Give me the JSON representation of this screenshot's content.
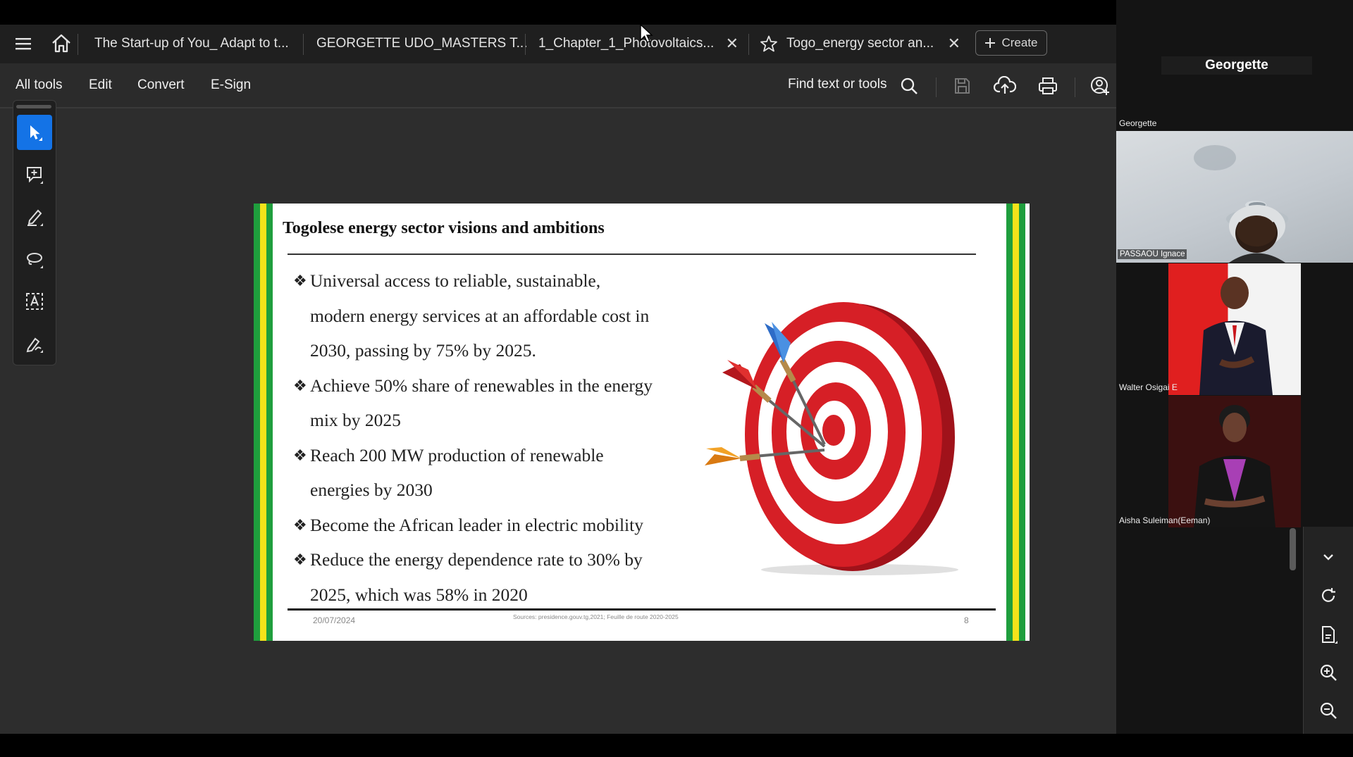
{
  "tabs": [
    {
      "label": "The Start-up of You_ Adapt to t..."
    },
    {
      "label": "GEORGETTE UDO_MASTERS T..."
    },
    {
      "label": "1_Chapter_1_Photovoltaics...",
      "close": "✕"
    },
    {
      "label": "Togo_energy sector an...",
      "close": "✕",
      "active": true
    }
  ],
  "create_label": "Create",
  "menus": [
    "All tools",
    "Edit",
    "Convert",
    "E-Sign"
  ],
  "find_label": "Find text or tools",
  "rail_tools": [
    "select-icon",
    "add-comment-icon",
    "highlight-pen-icon",
    "draw-lasso-icon",
    "text-recognition-icon",
    "sign-icon"
  ],
  "slide": {
    "title": "Togolese energy sector visions and ambitions",
    "bullets": [
      {
        "mark": "❖",
        "lines": [
          "Universal access to reliable, sustainable,",
          "modern energy services at an affordable cost in",
          "2030, passing by 75% by 2025."
        ]
      },
      {
        "mark": "❖",
        "lines": [
          "Achieve 50% share of renewables in the energy",
          "mix by 2025"
        ]
      },
      {
        "mark": "❖",
        "lines": [
          "Reach 200 MW  production of renewable",
          "energies by 2030"
        ]
      },
      {
        "mark": "❖",
        "lines": [
          "Become the African leader in electric mobility"
        ]
      },
      {
        "mark": "❖",
        "lines": [
          "Reduce the energy dependence rate to 30% by",
          "2025, which was 58% in 2020"
        ]
      }
    ],
    "date": "20/07/2024",
    "source": "Sources: presidence.gouv.tg,2021; Feuille de route 2020-2025",
    "page": "8",
    "image": "dartboard-target-icon"
  },
  "meeting": {
    "header_name": "Georgette",
    "top_label": "Georgette",
    "participants": [
      {
        "name": "PASSAOU Ignace"
      },
      {
        "name": "Walter Osigai E"
      },
      {
        "name": "Aisha Suleiman(Eeman)"
      }
    ]
  },
  "colors": {
    "accent": "#1473e6",
    "flag_green": "#1f9e3d",
    "flag_yellow": "#f4e31a",
    "dart_red": "#d61f26"
  }
}
